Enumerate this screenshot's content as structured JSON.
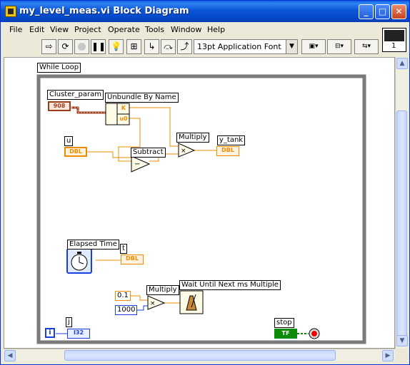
{
  "window": {
    "title": "my_level_meas.vi Block Diagram",
    "buttons": {
      "minimize": "_",
      "maximize": "□",
      "close": "✕"
    },
    "icon": "labview-vi-icon"
  },
  "menu": [
    {
      "label": "File",
      "key": "F"
    },
    {
      "label": "Edit",
      "key": "E"
    },
    {
      "label": "View",
      "key": "V"
    },
    {
      "label": "Project",
      "key": "P"
    },
    {
      "label": "Operate",
      "key": "O"
    },
    {
      "label": "Tools",
      "key": "T"
    },
    {
      "label": "Window",
      "key": "W"
    },
    {
      "label": "Help",
      "key": "H"
    }
  ],
  "vi_icon_number": "1",
  "toolbar": {
    "font": "13pt Application Font",
    "icons": [
      "run-arrow-icon",
      "run-continuously-icon",
      "abort-icon",
      "pause-icon",
      "highlight-execution-icon",
      "retain-wire-values-icon",
      "step-into-icon",
      "step-over-icon",
      "step-out-icon",
      "align-objects-icon",
      "distribute-objects-icon",
      "reorder-icon"
    ]
  },
  "diagram": {
    "while_loop": "While Loop",
    "nodes": {
      "cluster_param": "Cluster_param",
      "cluster_term": "908",
      "unbundle": "Unbundle By Name",
      "unbundle_k": "K",
      "unbundle_u0": "u0",
      "u": "u",
      "u_term": "DBL",
      "subtract": "Subtract",
      "multiply1": "Multiply",
      "y_tank": "y_tank",
      "y_tank_term": "DBL",
      "elapsed_time": "Elapsed Time",
      "t": "t",
      "t_term": "DBL",
      "multiply2": "Multiply",
      "const1": "0.1",
      "const2": "1000",
      "wait": "Wait Until Next ms Multiple",
      "j": "j",
      "i_term": "i",
      "j_term": "I32",
      "stop": "stop",
      "stop_term": "TF"
    }
  }
}
